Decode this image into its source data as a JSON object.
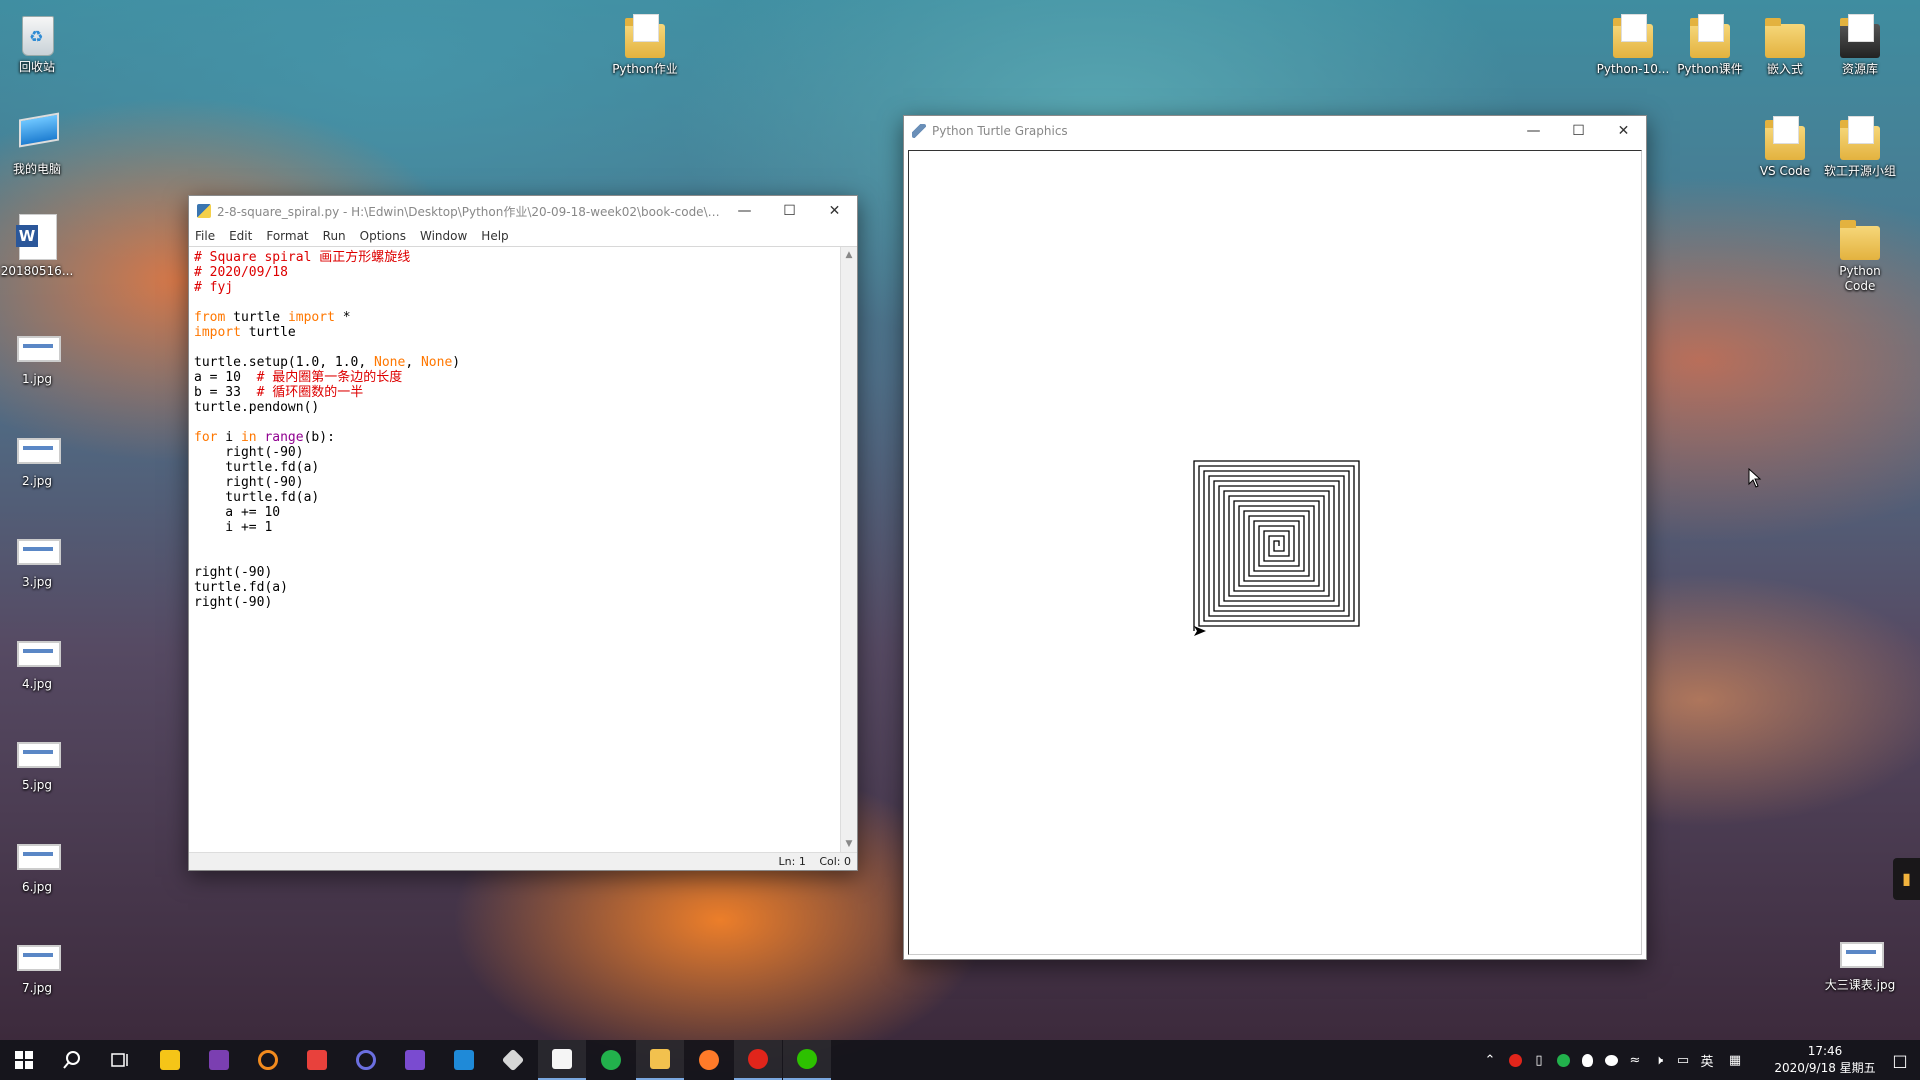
{
  "desktop": {
    "icons_left": [
      {
        "label": "回收站",
        "type": "recycle"
      },
      {
        "label": "我的电脑",
        "type": "pc"
      },
      {
        "label": "20180516...",
        "type": "word"
      },
      {
        "label": "1.jpg",
        "type": "thumb"
      },
      {
        "label": "2.jpg",
        "type": "thumb"
      },
      {
        "label": "3.jpg",
        "type": "thumb"
      },
      {
        "label": "4.jpg",
        "type": "thumb"
      },
      {
        "label": "5.jpg",
        "type": "thumb"
      },
      {
        "label": "6.jpg",
        "type": "thumb"
      },
      {
        "label": "7.jpg",
        "type": "thumb"
      }
    ],
    "icon_python_hw": "Python作业",
    "icons_right_top": [
      "Python-10...",
      "Python课件",
      "嵌入式",
      "资源库"
    ],
    "icon_vscode": "VS Code",
    "icon_ruangong": "软工开源小组",
    "icon_python_code": "Python\nCode",
    "icon_schedule": "大三课表.jpg"
  },
  "idle": {
    "title": "2-8-square_spiral.py - H:\\Edwin\\Desktop\\Python作业\\20-09-18-week02\\book-code\\2...",
    "menu": [
      "File",
      "Edit",
      "Format",
      "Run",
      "Options",
      "Window",
      "Help"
    ],
    "status_ln": "Ln: 1",
    "status_col": "Col: 0",
    "code": {
      "l1": "# Square spiral 画正方形螺旋线",
      "l2": "# 2020/09/18",
      "l3": "# fyj",
      "l5_kw1": "from",
      "l5_mid": " turtle ",
      "l5_kw2": "import",
      "l5_end": " *",
      "l6_kw": "import",
      "l6_end": " turtle",
      "l8_a": "turtle.setup(1.0, 1.0, ",
      "l8_n1": "None",
      "l8_sep": ", ",
      "l8_n2": "None",
      "l8_end": ")",
      "l9_a": "a = 10  ",
      "l9_c": "# 最内圈第一条边的长度",
      "l10_a": "b = 33  ",
      "l10_c": "# 循环圈数的一半",
      "l11": "turtle.pendown()",
      "l13_kw1": "for",
      "l13_a": " i ",
      "l13_kw2": "in",
      "l13_sp": " ",
      "l13_bi": "range",
      "l13_end": "(b):",
      "l14": "    right(-90)",
      "l15": "    turtle.fd(a)",
      "l16": "    right(-90)",
      "l17": "    turtle.fd(a)",
      "l18": "    a += 10",
      "l19": "    i += 1",
      "l22": "right(-90)",
      "l23": "turtle.fd(a)",
      "l24": "right(-90)"
    }
  },
  "turtle_window": {
    "title": "Python Turtle Graphics"
  },
  "taskbar": {
    "start_icon": "windows-start-icon",
    "input_indicator": "英",
    "clock_time": "17:46",
    "clock_date": "2020/9/18 星期五"
  },
  "colors": {
    "idle_comment": "#dd0000",
    "idle_keyword": "#ff7700",
    "idle_builtin": "#900090",
    "taskbar_bg": "#14141a"
  }
}
